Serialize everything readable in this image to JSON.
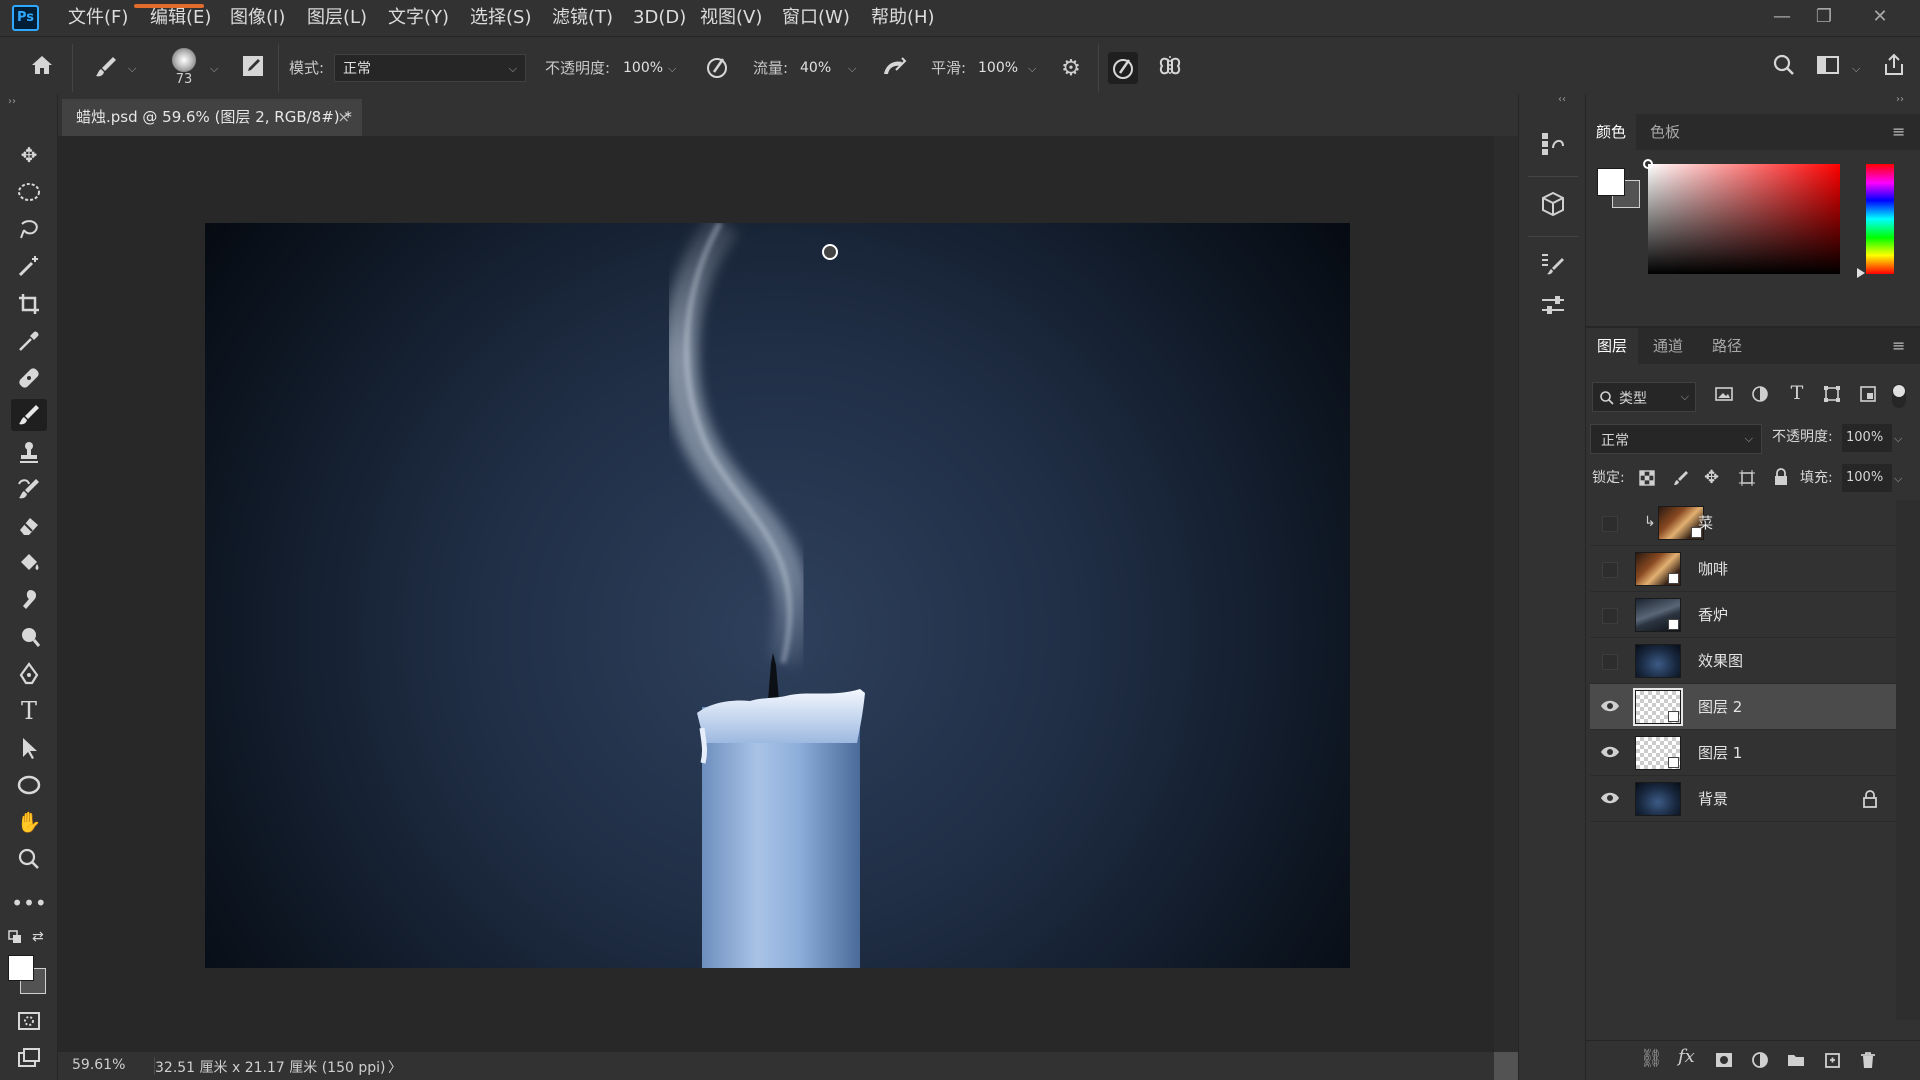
{
  "app": {
    "logo": "Ps"
  },
  "menu": [
    "文件(F)",
    "编辑(E)",
    "图像(I)",
    "图层(L)",
    "文字(Y)",
    "选择(S)",
    "滤镜(T)",
    "3D(D)",
    "视图(V)",
    "窗口(W)",
    "帮助(H)"
  ],
  "options": {
    "brush_size": "73",
    "mode_label": "模式:",
    "mode_value": "正常",
    "opacity_label": "不透明度:",
    "opacity_value": "100%",
    "flow_label": "流量:",
    "flow_value": "40%",
    "smooth_label": "平滑:",
    "smooth_value": "100%"
  },
  "document_tab": {
    "title": "蜡烛.psd @ 59.6% (图层 2, RGB/8#) *",
    "close": "×"
  },
  "status": {
    "zoom": "59.61%",
    "doc_size": "32.51 厘米 x 21.17 厘米 (150 ppi)",
    "arrow": "〉"
  },
  "color_panel": {
    "tabs": [
      "颜色",
      "色板"
    ],
    "active_tab": 0
  },
  "layers_panel": {
    "tabs": [
      "图层",
      "通道",
      "路径"
    ],
    "active_tab": 0,
    "filter_label": "类型",
    "blend_mode": "正常",
    "opacity_label": "不透明度:",
    "opacity_value": "100%",
    "lock_label": "锁定:",
    "fill_label": "填充:",
    "fill_value": "100%",
    "layers": [
      {
        "name": "菜",
        "visible": false,
        "clipped": true,
        "thumb": "photo-warm",
        "selected": false,
        "locked": false
      },
      {
        "name": "咖啡",
        "visible": false,
        "clipped": false,
        "thumb": "photo-warm",
        "selected": false,
        "locked": false
      },
      {
        "name": "香炉",
        "visible": false,
        "clipped": false,
        "thumb": "photo-dark",
        "selected": false,
        "locked": false
      },
      {
        "name": "效果图",
        "visible": false,
        "clipped": false,
        "thumb": "photo-blue",
        "selected": false,
        "locked": false
      },
      {
        "name": "图层 2",
        "visible": true,
        "clipped": false,
        "thumb": "transparent",
        "selected": true,
        "locked": false
      },
      {
        "name": "图层 1",
        "visible": true,
        "clipped": false,
        "thumb": "transparent",
        "selected": false,
        "locked": false
      },
      {
        "name": "背景",
        "visible": true,
        "clipped": false,
        "thumb": "photo-blue",
        "selected": false,
        "locked": true
      }
    ]
  },
  "colors": {
    "accent_blue": "#31a8ff",
    "foreground": "#ffffff",
    "hue_selected": "#ff0000"
  }
}
